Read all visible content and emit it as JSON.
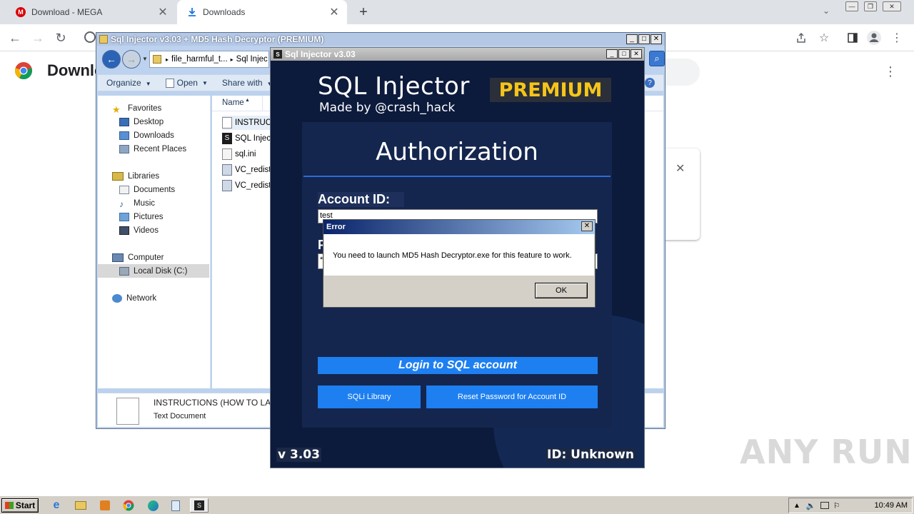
{
  "browser": {
    "tabs": [
      {
        "label": "Download - MEGA",
        "icon": "mega-icon"
      },
      {
        "label": "Downloads",
        "icon": "download-icon"
      }
    ],
    "page_title": "Downlo"
  },
  "explorer": {
    "title": "Sql Injector v3.03 + MD5 Hash Decryptor (PREMIUM)",
    "breadcrumb": [
      "file_harmful_t...",
      "Sql Injec"
    ],
    "toolbar": {
      "organize": "Organize",
      "open": "Open",
      "share_with": "Share with"
    },
    "nav": {
      "favorites": "Favorites",
      "desktop": "Desktop",
      "downloads": "Downloads",
      "recent_places": "Recent Places",
      "libraries": "Libraries",
      "documents": "Documents",
      "music": "Music",
      "pictures": "Pictures",
      "videos": "Videos",
      "computer": "Computer",
      "local_disk": "Local Disk (C:)",
      "network": "Network"
    },
    "column_name": "Name",
    "files": [
      "INSTRUC",
      "SQL Injec",
      "sql.ini",
      "VC_redist",
      "VC_redist"
    ],
    "details": {
      "name": "INSTRUCTIONS (HOW TO LA",
      "type": "Text Document"
    }
  },
  "sql_injector": {
    "window_title": "Sql Injector v3.03",
    "app_name": "SQL Injector",
    "made_by": "Made by @crash_hack",
    "badge": "PREMIUM",
    "auth_title": "Authorization",
    "account_label": "Account ID:",
    "account_value": "test",
    "password_label": "P",
    "password_value": "*",
    "login_button": "Login to SQL account",
    "library_button": "SQLi Library",
    "reset_button": "Reset Password for Account ID",
    "version": "v 3.03",
    "id_status": "ID: Unknown"
  },
  "error_dialog": {
    "title": "Error",
    "message": "You need to launch MD5 Hash Decryptor.exe for this feature to work.",
    "ok": "OK"
  },
  "watermark": "ANY RUN",
  "taskbar": {
    "start": "Start",
    "clock": "10:49 AM"
  },
  "colors": {
    "sql_bg": "#0c1a3c",
    "accent_blue": "#1e7ff0",
    "premium_yellow": "#f5c518"
  }
}
